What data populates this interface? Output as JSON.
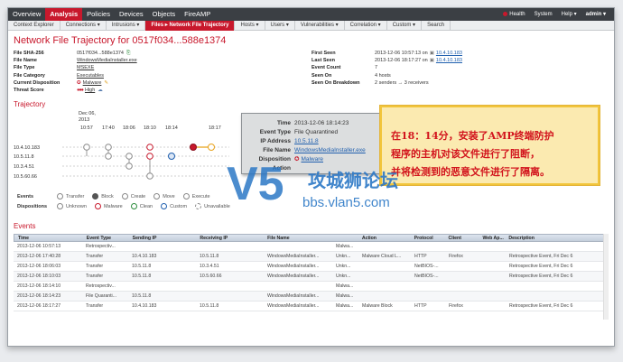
{
  "topnav": {
    "items": [
      "Overview",
      "Analysis",
      "Policies",
      "Devices",
      "Objects",
      "FireAMP"
    ],
    "active": "Analysis",
    "health": "Health",
    "system": "System",
    "help": "Help ▾",
    "user": "admin ▾"
  },
  "subnav": {
    "items": [
      "Context Explorer",
      "Connections ▾",
      "Intrusions ▾",
      "Files ▸ Network File Trajectory",
      "Hosts ▾",
      "Users ▾",
      "Vulnerabilities ▾",
      "Correlation ▾",
      "Custom ▾",
      "Search"
    ],
    "active_index": 3
  },
  "title": "Network File Trajectory for 0517f034...588e1374",
  "left_info": [
    {
      "k": "File SHA-256",
      "v": "0517f034...588e1374"
    },
    {
      "k": "File Name",
      "v": "WindowsMediaInstaller.exe"
    },
    {
      "k": "File Type",
      "v": "MSEXE"
    },
    {
      "k": "File Category",
      "v": "Executables"
    },
    {
      "k": "Current Disposition",
      "v": "Malware"
    },
    {
      "k": "Threat Score",
      "v": "High"
    }
  ],
  "right_info": [
    {
      "k": "First Seen",
      "v": "2013-12-06 10:57:13 on",
      "ip": "10.4.10.183"
    },
    {
      "k": "Last Seen",
      "v": "2013-12-06 18:17:27 on",
      "ip": "10.4.10.183"
    },
    {
      "k": "Event Count",
      "v": "7",
      "ip": ""
    },
    {
      "k": "Seen On",
      "v": "4 hosts",
      "ip": ""
    },
    {
      "k": "Seen On Breakdown",
      "v": "2 senders → 3 receivers",
      "ip": ""
    }
  ],
  "trajectory": {
    "title": "Trajectory",
    "date": "Dec 06,",
    "year": "2013",
    "times": [
      "10:57",
      "17:40",
      "18:06",
      "18:10",
      "18:14",
      "18:17"
    ],
    "hosts": [
      "10.4.10.183",
      "10.5.11.8",
      "10.3.4.51",
      "10.5.60.66"
    ]
  },
  "tooltip": {
    "rows": [
      {
        "k": "Time",
        "v": "2013-12-06 18:14:23"
      },
      {
        "k": "Event Type",
        "v": "File Quarantined"
      },
      {
        "k": "IP Address",
        "v": "10.5.11.8"
      },
      {
        "k": "File Name",
        "v": "WindowsMediaInstaller.exe"
      },
      {
        "k": "Disposition",
        "v": "Malware"
      },
      {
        "k": "Action",
        "v": ""
      }
    ]
  },
  "callout": {
    "line1": "在18：14分，安装了AMP终端防护",
    "line2": "程序的主机对该文件进行了阻断，",
    "line3": "并将检测到的恶意文件进行了隔离。"
  },
  "watermark": {
    "brand": "攻城狮论坛",
    "url": "bbs.vlan5.com",
    "logo": "V5"
  },
  "legend_events": {
    "label": "Events",
    "items": [
      "Transfer",
      "Block",
      "Create",
      "Move",
      "Execute"
    ]
  },
  "legend_disp": {
    "label": "Dispositions",
    "items": [
      "Unknown",
      "Malware",
      "Clean",
      "Custom",
      "Unavailable"
    ]
  },
  "events_title": "Events",
  "table": {
    "headers": [
      "Time",
      "Event Type",
      "Sending IP",
      "Receiving IP",
      "File Name",
      "",
      "Action",
      "Protocol",
      "Client",
      "Web Ap...",
      "Description"
    ],
    "rows": [
      [
        "2013-12-06 10:57:13",
        "Retrospectiv...",
        "",
        "",
        "",
        "Malwa...",
        "",
        "",
        "",
        "",
        ""
      ],
      [
        "2013-12-06 17:40:28",
        "Transfer",
        "10.4.10.183",
        "10.5.11.8",
        "WindowsMediaInstaller...",
        "Unkn...",
        "Malware Cloud L...",
        "HTTP",
        "Firefox",
        "",
        "Retrospective Event, Fri Dec 6"
      ],
      [
        "2013-12-06 18:06:03",
        "Transfer",
        "10.5.11.8",
        "10.3.4.51",
        "WindowsMediaInstaller...",
        "Unkn...",
        "",
        "NetBIOS-...",
        "",
        "",
        "Retrospective Event, Fri Dec 6"
      ],
      [
        "2013-12-06 18:10:03",
        "Transfer",
        "10.5.11.8",
        "10.5.60.66",
        "WindowsMediaInstaller...",
        "Unkn...",
        "",
        "NetBIOS-...",
        "",
        "",
        "Retrospective Event, Fri Dec 6"
      ],
      [
        "2013-12-06 18:14:10",
        "Retrospectiv...",
        "",
        "",
        "",
        "Malwa...",
        "",
        "",
        "",
        "",
        ""
      ],
      [
        "2013-12-06 18:14:23",
        "File Quaranti...",
        "10.5.11.8",
        "",
        "WindowsMediaInstaller...",
        "Malwa...",
        "",
        "",
        "",
        "",
        ""
      ],
      [
        "2013-12-06 18:17:27",
        "Transfer",
        "10.4.10.183",
        "10.5.11.8",
        "WindowsMediaInstaller...",
        "Malwa...",
        "Malware Block",
        "HTTP",
        "Firefox",
        "",
        "Retrospective Event, Fri Dec 6"
      ]
    ]
  },
  "colors": {
    "accent": "#c8182c",
    "nav": "#3b3f44",
    "link": "#1f5fae",
    "callout_bg": "#fbeab0",
    "callout_text": "#d2141d"
  }
}
